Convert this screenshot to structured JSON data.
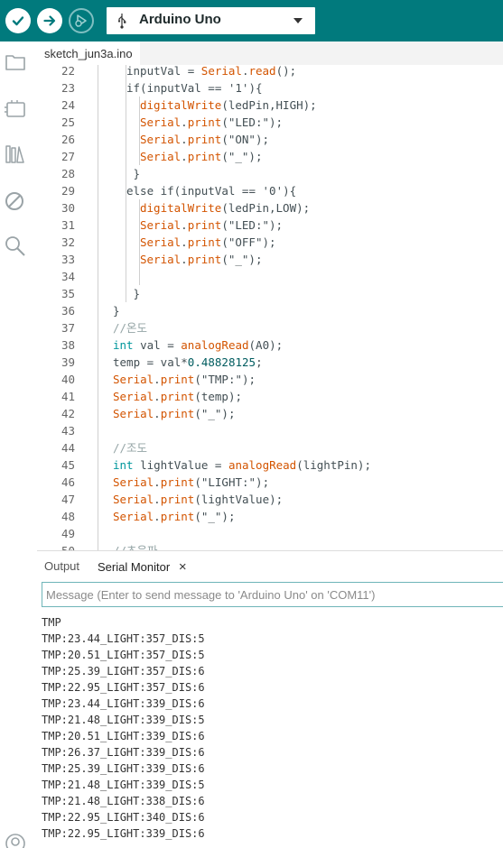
{
  "toolbar": {
    "verify_icon": "check-icon",
    "upload_icon": "arrow-right-icon",
    "debug_icon": "debug-icon",
    "board_select": {
      "value": "Arduino Uno",
      "icon": "usb-icon"
    },
    "colors": {
      "bar": "#017a7d",
      "button": "#ffffff"
    }
  },
  "sidebar": {
    "icons": [
      "folder-icon",
      "board-icon",
      "library-icon",
      "debug-block-icon",
      "search-icon",
      "profile-icon"
    ]
  },
  "editor": {
    "file_tab": "sketch_jun3a.ino",
    "lines": [
      {
        "n": "22",
        "indent": 1,
        "parts": [
          [
            "plain",
            "inputVal = "
          ],
          [
            "fn",
            "Serial"
          ],
          [
            "plain",
            "."
          ],
          [
            "fn",
            "read"
          ],
          [
            "plain",
            "();"
          ]
        ]
      },
      {
        "n": "23",
        "indent": 1,
        "parts": [
          [
            "plain",
            "if(inputVal == '1'){"
          ]
        ]
      },
      {
        "n": "24",
        "indent": 2,
        "parts": [
          [
            "fn",
            "digitalWrite"
          ],
          [
            "plain",
            "(ledPin,HIGH);"
          ]
        ]
      },
      {
        "n": "25",
        "indent": 2,
        "parts": [
          [
            "fn",
            "Serial"
          ],
          [
            "plain",
            "."
          ],
          [
            "fn",
            "print"
          ],
          [
            "plain",
            "(\"LED:\");"
          ]
        ]
      },
      {
        "n": "26",
        "indent": 2,
        "parts": [
          [
            "fn",
            "Serial"
          ],
          [
            "plain",
            "."
          ],
          [
            "fn",
            "print"
          ],
          [
            "plain",
            "(\"ON\");"
          ]
        ]
      },
      {
        "n": "27",
        "indent": 2,
        "parts": [
          [
            "fn",
            "Serial"
          ],
          [
            "plain",
            "."
          ],
          [
            "fn",
            "print"
          ],
          [
            "plain",
            "(\"_\");"
          ]
        ]
      },
      {
        "n": "28",
        "indent": 1,
        "parts": [
          [
            "plain",
            " }"
          ]
        ]
      },
      {
        "n": "29",
        "indent": 1,
        "parts": [
          [
            "plain",
            "else if(inputVal == '0'){"
          ]
        ]
      },
      {
        "n": "30",
        "indent": 2,
        "parts": [
          [
            "fn",
            "digitalWrite"
          ],
          [
            "plain",
            "(ledPin,LOW);"
          ]
        ]
      },
      {
        "n": "31",
        "indent": 2,
        "parts": [
          [
            "fn",
            "Serial"
          ],
          [
            "plain",
            "."
          ],
          [
            "fn",
            "print"
          ],
          [
            "plain",
            "(\"LED:\");"
          ]
        ]
      },
      {
        "n": "32",
        "indent": 2,
        "parts": [
          [
            "fn",
            "Serial"
          ],
          [
            "plain",
            "."
          ],
          [
            "fn",
            "print"
          ],
          [
            "plain",
            "(\"OFF\");"
          ]
        ]
      },
      {
        "n": "33",
        "indent": 2,
        "parts": [
          [
            "fn",
            "Serial"
          ],
          [
            "plain",
            "."
          ],
          [
            "fn",
            "print"
          ],
          [
            "plain",
            "(\"_\");"
          ]
        ]
      },
      {
        "n": "34",
        "indent": 2,
        "parts": []
      },
      {
        "n": "35",
        "indent": 1,
        "parts": [
          [
            "plain",
            " }"
          ]
        ]
      },
      {
        "n": "36",
        "indent": 0,
        "parts": [
          [
            "plain",
            "}"
          ]
        ]
      },
      {
        "n": "37",
        "indent": 0,
        "parts": [
          [
            "comment",
            "//온도"
          ]
        ]
      },
      {
        "n": "38",
        "indent": 0,
        "parts": [
          [
            "kw",
            "int"
          ],
          [
            "plain",
            " val = "
          ],
          [
            "fn",
            "analogRead"
          ],
          [
            "plain",
            "(A0);"
          ]
        ]
      },
      {
        "n": "39",
        "indent": 0,
        "parts": [
          [
            "plain",
            "temp = val*"
          ],
          [
            "num",
            "0.48828125"
          ],
          [
            "plain",
            ";"
          ]
        ]
      },
      {
        "n": "40",
        "indent": 0,
        "parts": [
          [
            "fn",
            "Serial"
          ],
          [
            "plain",
            "."
          ],
          [
            "fn",
            "print"
          ],
          [
            "plain",
            "(\"TMP:\");"
          ]
        ]
      },
      {
        "n": "41",
        "indent": 0,
        "parts": [
          [
            "fn",
            "Serial"
          ],
          [
            "plain",
            "."
          ],
          [
            "fn",
            "print"
          ],
          [
            "plain",
            "(temp);"
          ]
        ]
      },
      {
        "n": "42",
        "indent": 0,
        "parts": [
          [
            "fn",
            "Serial"
          ],
          [
            "plain",
            "."
          ],
          [
            "fn",
            "print"
          ],
          [
            "plain",
            "(\"_\");"
          ]
        ]
      },
      {
        "n": "43",
        "indent": 0,
        "parts": []
      },
      {
        "n": "44",
        "indent": 0,
        "parts": [
          [
            "comment",
            "//조도"
          ]
        ]
      },
      {
        "n": "45",
        "indent": 0,
        "parts": [
          [
            "kw",
            "int"
          ],
          [
            "plain",
            " lightValue = "
          ],
          [
            "fn",
            "analogRead"
          ],
          [
            "plain",
            "(lightPin);"
          ]
        ]
      },
      {
        "n": "46",
        "indent": 0,
        "parts": [
          [
            "fn",
            "Serial"
          ],
          [
            "plain",
            "."
          ],
          [
            "fn",
            "print"
          ],
          [
            "plain",
            "(\"LIGHT:\");"
          ]
        ]
      },
      {
        "n": "47",
        "indent": 0,
        "parts": [
          [
            "fn",
            "Serial"
          ],
          [
            "plain",
            "."
          ],
          [
            "fn",
            "print"
          ],
          [
            "plain",
            "(lightValue);"
          ]
        ]
      },
      {
        "n": "48",
        "indent": 0,
        "parts": [
          [
            "fn",
            "Serial"
          ],
          [
            "plain",
            "."
          ],
          [
            "fn",
            "print"
          ],
          [
            "plain",
            "(\"_\");"
          ]
        ]
      },
      {
        "n": "49",
        "indent": 0,
        "parts": []
      },
      {
        "n": "50",
        "indent": 0,
        "parts": [
          [
            "comment",
            "//초음파"
          ]
        ]
      }
    ],
    "colors": {
      "plain": "#434f54",
      "fn": "#d35400",
      "kw": "#00979c",
      "num": "#005c5f",
      "comment": "#95a5a6",
      "line_number": "#666666"
    }
  },
  "panel": {
    "tabs": [
      {
        "label": "Output",
        "active": false
      },
      {
        "label": "Serial Monitor",
        "active": true,
        "close": "×"
      }
    ],
    "input_placeholder": "Message (Enter to send message to 'Arduino Uno' on 'COM11')",
    "output_lines": [
      "TMP",
      "TMP:23.44_LIGHT:357_DIS:5",
      "TMP:20.51_LIGHT:357_DIS:5",
      "TMP:25.39_LIGHT:357_DIS:6",
      "TMP:22.95_LIGHT:357_DIS:6",
      "TMP:23.44_LIGHT:339_DIS:6",
      "TMP:21.48_LIGHT:339_DIS:5",
      "TMP:20.51_LIGHT:339_DIS:6",
      "TMP:26.37_LIGHT:339_DIS:6",
      "TMP:25.39_LIGHT:339_DIS:6",
      "TMP:21.48_LIGHT:339_DIS:5",
      "TMP:21.48_LIGHT:338_DIS:6",
      "TMP:22.95_LIGHT:340_DIS:6",
      "TMP:22.95_LIGHT:339_DIS:6"
    ]
  }
}
